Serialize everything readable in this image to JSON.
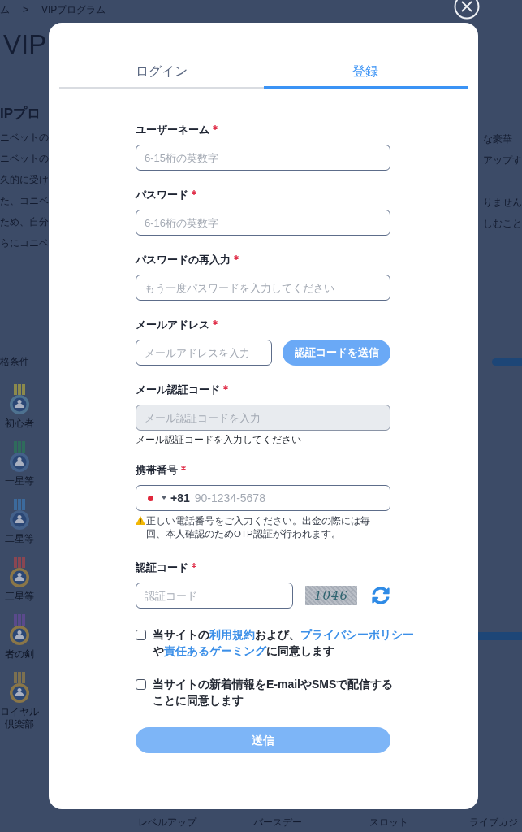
{
  "background": {
    "breadcrumb": [
      "ム",
      ">",
      "VIPプログラム"
    ],
    "page_title": "VIP",
    "section_title": "IPプロ",
    "paragraph_lines": [
      {
        "left": "ニベットの",
        "right": "な豪華"
      },
      {
        "left": "ニベットの",
        "right": "アップす"
      },
      {
        "left": "久的に受け"
      },
      {
        "left": "た、コニベ",
        "right": "りません"
      },
      {
        "left": "ため、自分",
        "right": "しむこと"
      },
      {
        "left": "らにコニベ"
      }
    ],
    "requirements_label": "格条件",
    "ranks": [
      "初心者",
      "一星等",
      "二星等",
      "三星等",
      "者の剣",
      "ロイヤル倶楽部"
    ],
    "bottom_tabs": [
      "レベルアップ",
      "バースデー",
      "スロット",
      "ライブカジ"
    ]
  },
  "modal": {
    "tabs": [
      {
        "label": "ログイン",
        "selected": false
      },
      {
        "label": "登録",
        "selected": true
      }
    ],
    "fields": [
      {
        "kind": "text",
        "label": "ユーザーネーム",
        "required": true,
        "disabled": false,
        "placeholder": "6-15桁の英数字"
      },
      {
        "kind": "text",
        "label": "パスワード",
        "required": true,
        "disabled": false,
        "placeholder": "6-16桁の英数字"
      },
      {
        "kind": "text",
        "label": "パスワードの再入力",
        "required": true,
        "disabled": false,
        "placeholder": "もう一度パスワードを入力してください"
      },
      {
        "kind": "email",
        "label": "メールアドレス",
        "required": true,
        "disabled": false,
        "placeholder": "メールアドレスを入力",
        "button": "認証コードを送信"
      },
      {
        "kind": "text",
        "label": "メール認証コード",
        "required": true,
        "disabled": true,
        "placeholder": "メール認証コードを入力",
        "hint": "メール認証コードを入力してください"
      },
      {
        "kind": "phone",
        "label": "携帯番号",
        "required": true,
        "disabled": false,
        "dial_code": "+81",
        "placeholder": "90-1234-5678",
        "warning": "正しい電話番号をご入力ください。出金の際には毎回、本人確認のためOTP認証が行われます。"
      },
      {
        "kind": "captcha",
        "label": "認証コード",
        "required": true,
        "disabled": false,
        "placeholder": "認証コード",
        "captcha_text": "1046"
      }
    ],
    "consents": [
      {
        "checked": false,
        "parts": [
          {
            "kind": "text",
            "text": "当サイトの"
          },
          {
            "kind": "link",
            "text": "利用規約"
          },
          {
            "kind": "text",
            "text": "および、"
          },
          {
            "kind": "link",
            "text": "プライバシーポリシー"
          },
          {
            "kind": "text",
            "text": "や"
          },
          {
            "kind": "link",
            "text": "責任あるゲーミング"
          },
          {
            "kind": "text",
            "text": "に同意します"
          }
        ]
      },
      {
        "checked": false,
        "parts": [
          {
            "kind": "text",
            "text": "当サイトの新着情報をE-mailやSMSで配信することに同意します"
          }
        ]
      }
    ],
    "submit": "送信"
  }
}
